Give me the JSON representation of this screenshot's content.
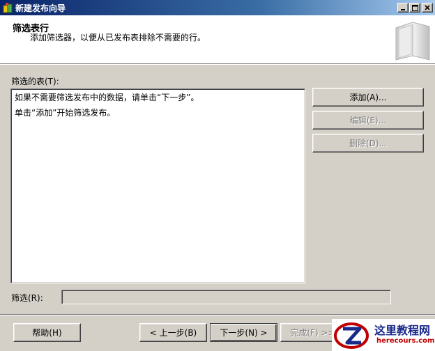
{
  "window": {
    "title": "新建发布向导",
    "controls": [
      "minimize-icon",
      "maximize-icon",
      "close-icon"
    ]
  },
  "header": {
    "title": "筛选表行",
    "subtitle": "添加筛选器，以便从已发布表排除不需要的行。",
    "art_icon": "book-icon"
  },
  "filtered_tables": {
    "label": "筛选的表(T):",
    "lines": [
      "如果不需要筛选发布中的数据，请单击“下一步”。",
      "单击“添加”开始筛选发布。"
    ]
  },
  "side_buttons": {
    "add": "添加(A)...",
    "edit": "编辑(E)...",
    "delete": "删除(D)..."
  },
  "filter": {
    "label": "筛选(R):",
    "value": ""
  },
  "footer": {
    "help": "帮助(H)",
    "back": "< 上一步(B)",
    "next": "下一步(N) >",
    "finish": "完成(F) >>|"
  },
  "watermark": {
    "title": "这里教程网",
    "url": "herecours.com"
  },
  "colors": {
    "dialog_bg": "#d4d0c8",
    "titlebar_start": "#0a246a",
    "titlebar_end": "#a6caf0",
    "disabled_text": "#808080",
    "watermark_title": "#1a2a8a",
    "watermark_url": "#c00000"
  }
}
